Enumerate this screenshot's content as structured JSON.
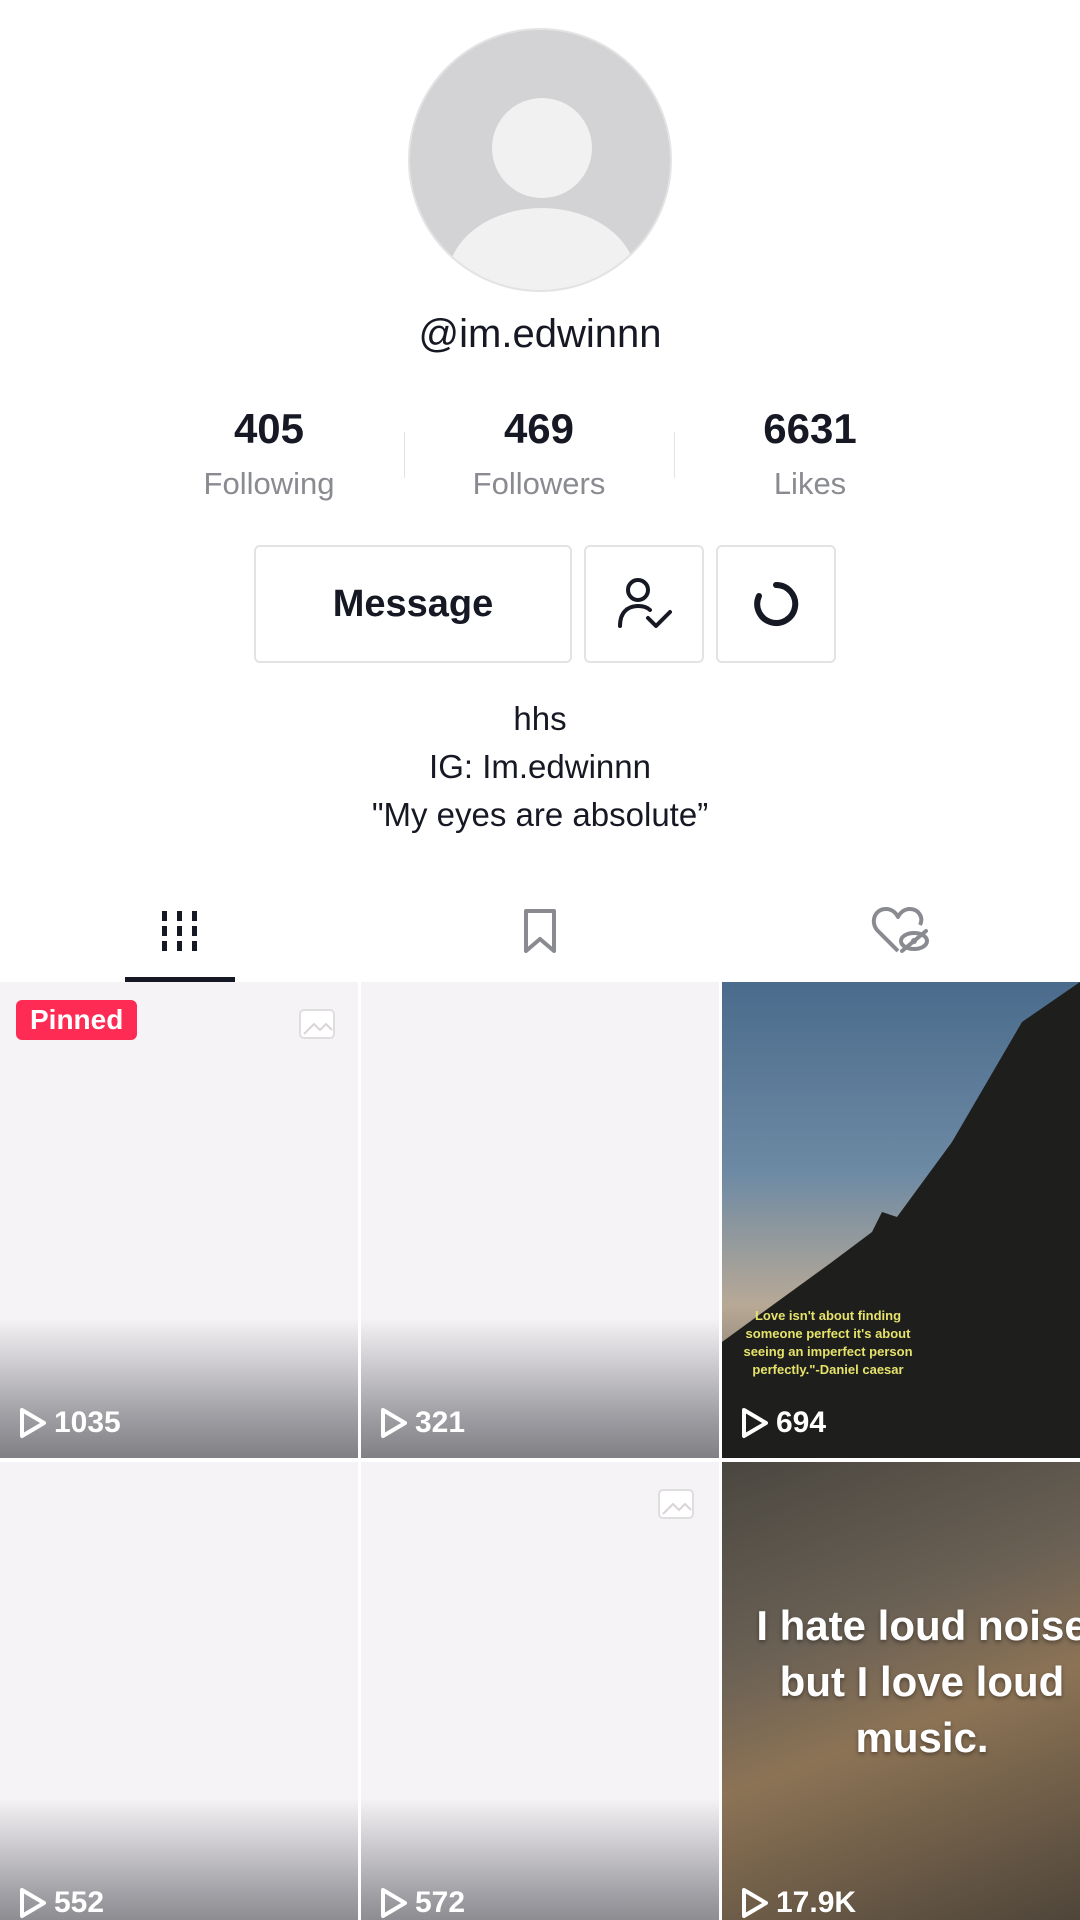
{
  "profile": {
    "username": "@im.edwinnn",
    "stats": [
      {
        "value": "405",
        "label": "Following"
      },
      {
        "value": "469",
        "label": "Followers"
      },
      {
        "value": "6631",
        "label": "Likes"
      }
    ],
    "message_label": "Message",
    "bio": [
      "hhs",
      "IG: Im.edwinnn",
      "\"My eyes are absolute”"
    ]
  },
  "tabs": [
    {
      "icon": "videos-grid-icon",
      "active": true
    },
    {
      "icon": "bookmark-icon",
      "active": false
    },
    {
      "icon": "liked-hidden-icon",
      "active": false
    }
  ],
  "videos": [
    {
      "views": "1035",
      "pinned": "Pinned",
      "has_photo_icon": true
    },
    {
      "views": "321"
    },
    {
      "views": "694",
      "caption": "Love isn't about finding someone perfect it's about seeing an imperfect person perfectly.\"-Daniel caesar"
    },
    {
      "views": "552"
    },
    {
      "views": "572",
      "has_photo_icon": true
    },
    {
      "views": "17.9K",
      "caption": "I hate loud noise but I love loud music."
    }
  ],
  "colors": {
    "pinned_badge": "#fe2c55",
    "text": "#161823",
    "secondary_text": "#8a8b91",
    "divider": "#e3e3e4"
  }
}
